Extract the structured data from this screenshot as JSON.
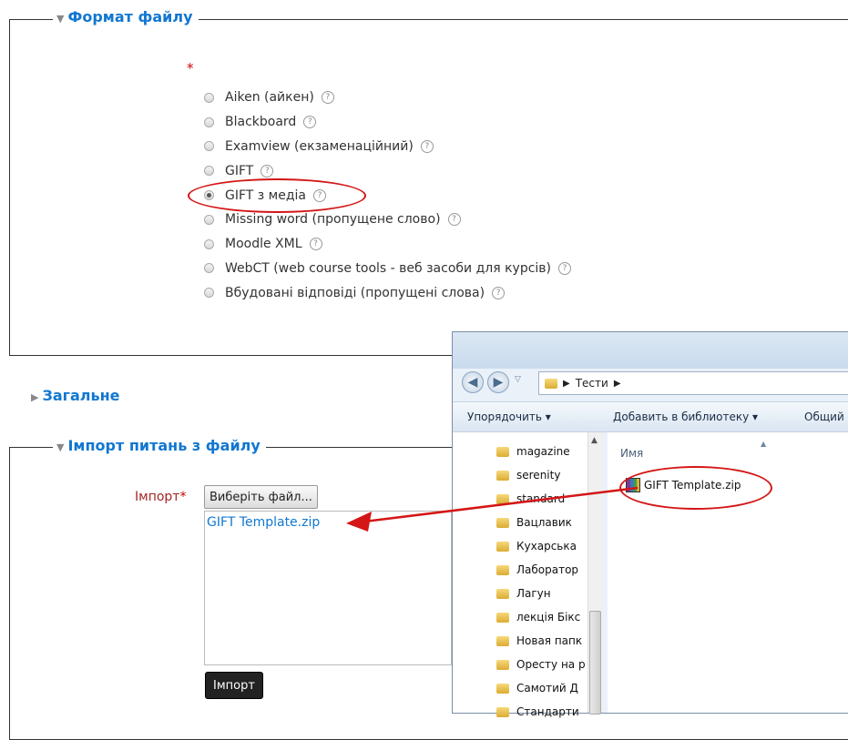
{
  "format_section": {
    "legend": "Формат файлу",
    "required_mark": "*",
    "options": [
      {
        "label": "Aiken (айкен)",
        "checked": false
      },
      {
        "label": "Blackboard",
        "checked": false
      },
      {
        "label": "Examview (екзаменаційний)",
        "checked": false
      },
      {
        "label": "GIFT",
        "checked": false
      },
      {
        "label": "GIFT з медіа",
        "checked": true
      },
      {
        "label": "Missing word (пропущене слово)",
        "checked": false
      },
      {
        "label": "Moodle XML",
        "checked": false
      },
      {
        "label": "WebCT (web course tools - веб засоби для курсів)",
        "checked": false
      },
      {
        "label": "Вбудовані відповіді (пропущені слова)",
        "checked": false
      }
    ],
    "help_glyph": "?"
  },
  "general_section": {
    "legend": "Загальне"
  },
  "import_section": {
    "legend": "Імпорт питань з файлу",
    "field_label": "Імпорт",
    "required_mark": "*",
    "choose_button": "Виберіть файл...",
    "selected_file": "GIFT Template.zip",
    "import_button": "Імпорт"
  },
  "explorer": {
    "breadcrumb": [
      "Тести"
    ],
    "toolbar": [
      "Упорядочить ▾",
      "Добавить в библиотеку ▾",
      "Общий"
    ],
    "tree": [
      "magazine",
      "serenity",
      "standard",
      "Вацлавик",
      "Кухарська",
      "Лаборатор",
      "Лагун",
      "лекція Бікс",
      "Новая папк",
      "Оресту на р",
      "Самотий Д",
      "Стандарти"
    ],
    "column_header": "Имя",
    "file": "GIFT Template.zip"
  },
  "colors": {
    "accent": "#1177d1",
    "annotation": "#d41616"
  }
}
